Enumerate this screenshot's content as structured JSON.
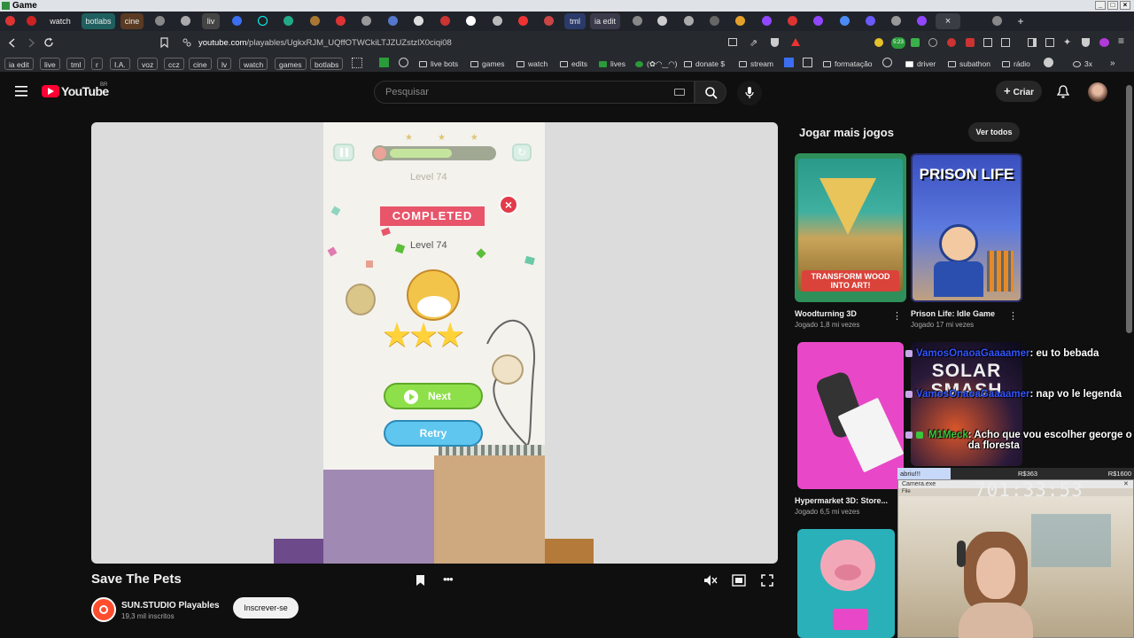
{
  "window": {
    "title": "Game"
  },
  "tabs": [
    {
      "label": "ia edit",
      "color": "#6a3a3a"
    },
    {
      "label": "watch",
      "color": "#a03535"
    },
    {
      "label": "botlabs",
      "color": "#1f6f6f"
    },
    {
      "label": "cine",
      "color": "#6a4a2a"
    },
    {
      "label": "liv",
      "color": "#3a3a3a"
    },
    {
      "label": "tml",
      "color": "#2a3a6a"
    },
    {
      "label": "ia edit",
      "color": "#3a3a3a"
    }
  ],
  "address": {
    "url_domain": "youtube.com",
    "url_path": "/playables/UgkxRJM_UQffOTWCkiLTJZUZstzlX0ciqi08"
  },
  "bookmarks": [
    {
      "label": "ia edit",
      "pill": true
    },
    {
      "label": "live",
      "pill": true
    },
    {
      "label": "tml",
      "pill": true
    },
    {
      "label": "r",
      "pill": true
    },
    {
      "label": "I.A.",
      "pill": true
    },
    {
      "label": "voz",
      "pill": true
    },
    {
      "label": "ccz",
      "pill": true
    },
    {
      "label": "cine",
      "pill": true
    },
    {
      "label": "lv",
      "pill": true
    },
    {
      "label": "watch",
      "pill": true
    },
    {
      "label": "games",
      "pill": true
    },
    {
      "label": "botlabs",
      "pill": true
    },
    {
      "label": "live bots",
      "pill": false
    },
    {
      "label": "games",
      "pill": false
    },
    {
      "label": "watch",
      "pill": false
    },
    {
      "label": "edits",
      "pill": false
    },
    {
      "label": "lives",
      "pill": false
    },
    {
      "label": "(✿◠‿◠)",
      "pill": false
    },
    {
      "label": "donate $",
      "pill": false
    },
    {
      "label": "stream",
      "pill": false
    },
    {
      "label": "formatação",
      "pill": false
    },
    {
      "label": "driver",
      "pill": false
    },
    {
      "label": "subathon",
      "pill": false
    },
    {
      "label": "rádio",
      "pill": false
    },
    {
      "label": "3x",
      "pill": false
    }
  ],
  "ext_badge": "5:23",
  "youtube": {
    "logo": "YouTube",
    "region": "BR",
    "search_placeholder": "Pesquisar",
    "create": "Criar"
  },
  "game": {
    "level_top": "Level 74",
    "completed": "COMPLETED",
    "level_card": "Level 74",
    "next": "Next",
    "retry": "Retry",
    "progress": 0.6
  },
  "right": {
    "heading": "Jogar mais jogos",
    "see_all": "Ver todos",
    "cards": [
      {
        "title": "Woodturning 3D",
        "meta": "Jogado 1,8 mi vezes",
        "thumb_text": "TRANSFORM WOOD INTO ART!"
      },
      {
        "title": "Prison Life: Idle Game",
        "meta": "Jogado 17 mi vezes",
        "thumb_text": "PRISON LIFE"
      },
      {
        "title": "Hypermarket 3D: Store...",
        "meta": "Jogado 6,5 mi vezes",
        "thumb_text": ""
      },
      {
        "title": "",
        "meta": "",
        "thumb_text": "SOLAR SMASH"
      }
    ]
  },
  "chat": [
    {
      "user": "VamosOnaoaGaaaamer",
      "text": ": eu to bebada"
    },
    {
      "user": "VamosOnaoaGaaaamer",
      "text": ": nap vo le legenda"
    },
    {
      "user": "M1Meck",
      "text": ": Acho que vou escolher george o rei da floresta"
    }
  ],
  "overlay": {
    "goal_label": "abriu!!!",
    "goal_current": "R$363",
    "goal_target": "R$1600",
    "cam_title": "Camera.exe",
    "cam_menu": "File",
    "timer": "701:33:53"
  },
  "video": {
    "title": "Save The Pets",
    "channel": "SUN.STUDIO Playables",
    "subs": "19,3 mil inscritos",
    "subscribe": "Inscrever-se"
  },
  "colors": {
    "accent_red": "#ff0033",
    "next_green": "#8ee04a",
    "retry_blue": "#5fc6ef",
    "completed_ribbon": "#e8546a",
    "star": "#ffd23a"
  }
}
